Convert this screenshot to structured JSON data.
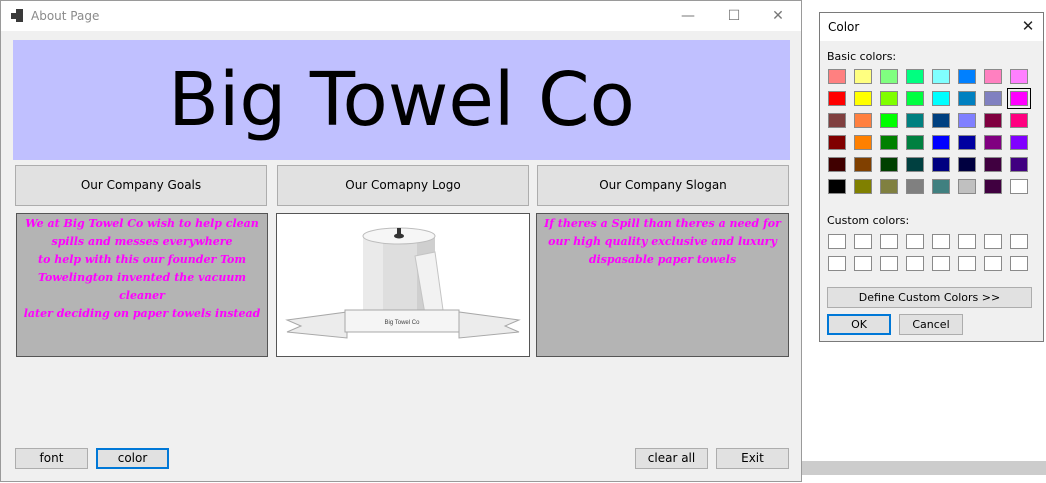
{
  "main_window": {
    "title": "About Page",
    "controls": {
      "minimize": "—",
      "maximize": "☐",
      "close": "✕"
    },
    "banner": {
      "text": "Big Towel Co",
      "background": "#c0c0ff"
    },
    "tabs": [
      {
        "label": "Our Company Goals"
      },
      {
        "label": "Our Comapny Logo"
      },
      {
        "label": "Our Company Slogan"
      }
    ],
    "goals_text": [
      "We at Big Towel Co wish to help clean",
      "spills and messes everywhere",
      "to help with this our founder Tom",
      "Towelington invented the vacuum cleaner",
      "later deciding on paper towels instead"
    ],
    "slogan_text": [
      "If theres a Spill than theres a need for",
      "our high quality exclusive and luxury",
      "dispasable paper towels"
    ],
    "logo_banner_text": "Big Towel Co",
    "text_color": "#ff00ff",
    "buttons": {
      "font": "font",
      "color": "color",
      "clear_all": "clear all",
      "exit": "Exit"
    }
  },
  "color_dialog": {
    "title": "Color",
    "close": "✕",
    "basic_label": "Basic colors:",
    "custom_label": "Custom colors:",
    "basic_colors": [
      [
        "#ff8080",
        "#ffff80",
        "#80ff80",
        "#00ff80",
        "#80ffff",
        "#0080ff",
        "#ff80c0",
        "#ff80ff"
      ],
      [
        "#ff0000",
        "#ffff00",
        "#80ff00",
        "#00ff40",
        "#00ffff",
        "#0080c0",
        "#8080c0",
        "#ff00ff"
      ],
      [
        "#804040",
        "#ff8040",
        "#00ff00",
        "#008080",
        "#004080",
        "#8080ff",
        "#800040",
        "#ff0080"
      ],
      [
        "#800000",
        "#ff8000",
        "#008000",
        "#008040",
        "#0000ff",
        "#0000a0",
        "#800080",
        "#8000ff"
      ],
      [
        "#400000",
        "#804000",
        "#004000",
        "#004040",
        "#000080",
        "#000040",
        "#400040",
        "#400080"
      ],
      [
        "#000000",
        "#808000",
        "#808040",
        "#808080",
        "#408080",
        "#c0c0c0",
        "#400040",
        "#ffffff"
      ]
    ],
    "selected": {
      "row": 1,
      "col": 7
    },
    "custom_colors": [
      [
        "#ffffff",
        "#ffffff",
        "#ffffff",
        "#ffffff",
        "#ffffff",
        "#ffffff",
        "#ffffff",
        "#ffffff"
      ],
      [
        "#ffffff",
        "#ffffff",
        "#ffffff",
        "#ffffff",
        "#ffffff",
        "#ffffff",
        "#ffffff",
        "#ffffff"
      ]
    ],
    "define_label": "Define Custom Colors >>",
    "ok_label": "OK",
    "cancel_label": "Cancel"
  }
}
